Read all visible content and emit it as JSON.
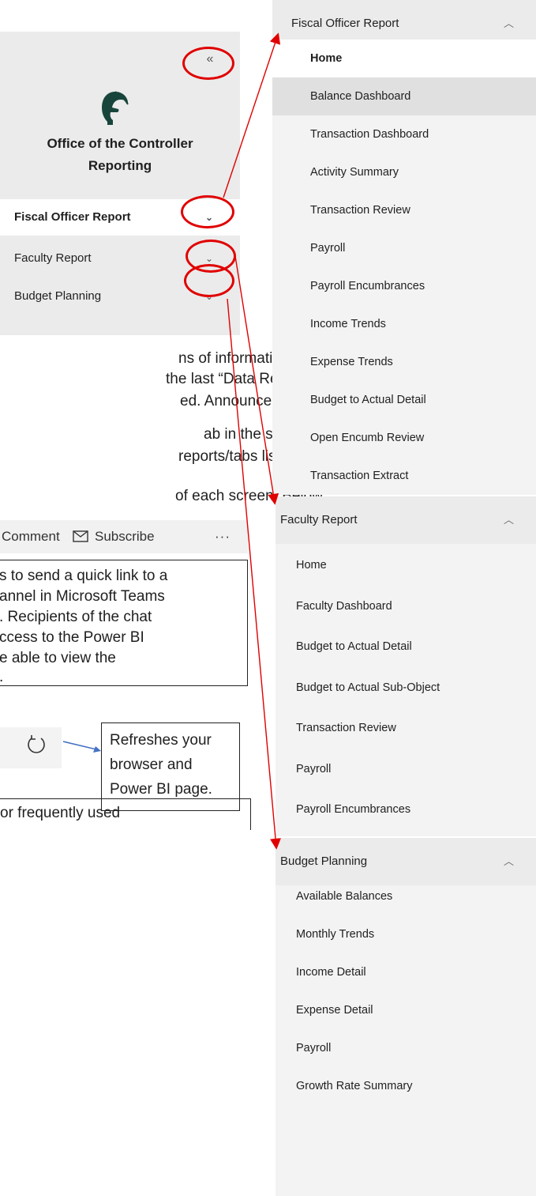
{
  "nav": {
    "collapse_glyph": "«",
    "title_line1": "Office of the Controller",
    "title_line2": "Reporting",
    "items": [
      {
        "label": "Fiscal Officer Report",
        "chevron": "⌄"
      },
      {
        "label": "Faculty Report",
        "chevron": "⌄"
      },
      {
        "label": "Budget Planning",
        "chevron": "⌄"
      }
    ]
  },
  "body_text": {
    "p1_l1": "ns of information on the",
    "p1_l2": " the last “Data Refreshed”",
    "p1_l3": "ed.  Announcements may",
    "p2_l1": "ab in the system for",
    "p2_l2": "reports/tabs listed in each",
    "p3_l1": "of each screen.  Below"
  },
  "toolbar": {
    "comment_label": "Comment",
    "subscribe_label": "Subscribe",
    "more_label": "···"
  },
  "callout_chat": {
    "l1": "s to send a quick link to a",
    "l2": "annel in Microsoft Teams",
    "l3": ".  Recipients of the chat",
    "l4": "ccess to the Power BI",
    "l5": "e able to view the",
    "l6": "."
  },
  "refresh_callout": {
    "l1": "Refreshes your",
    "l2": "browser and",
    "l3": "Power BI page."
  },
  "bottom_callout": {
    "l1": "or frequently used"
  },
  "menus": {
    "fiscal": {
      "header": "Fiscal Officer Report",
      "chevron": "︿",
      "items": [
        "Home",
        "Balance Dashboard",
        "Transaction Dashboard",
        "Activity Summary",
        "Transaction Review",
        "Payroll",
        "Payroll Encumbrances",
        "Income Trends",
        "Expense Trends",
        "Budget to Actual Detail",
        "Open Encumb Review",
        "Transaction Extract"
      ]
    },
    "faculty": {
      "header": "Faculty Report",
      "chevron": "︿",
      "items": [
        "Home",
        "Faculty Dashboard",
        "Budget to Actual Detail",
        "Budget to Actual Sub-Object",
        "Transaction Review",
        "Payroll",
        "Payroll Encumbrances"
      ]
    },
    "budget": {
      "header": "Budget Planning",
      "chevron": "︿",
      "items": [
        "Available Balances",
        "Monthly Trends",
        "Income Detail",
        "Expense Detail",
        "Payroll",
        "Growth Rate Summary"
      ]
    }
  },
  "colors": {
    "annotation_red": "#e00000",
    "arrow_blue": "#4472c4",
    "nav_bg": "#ebebeb",
    "menu_bg": "#f3f3f3"
  }
}
